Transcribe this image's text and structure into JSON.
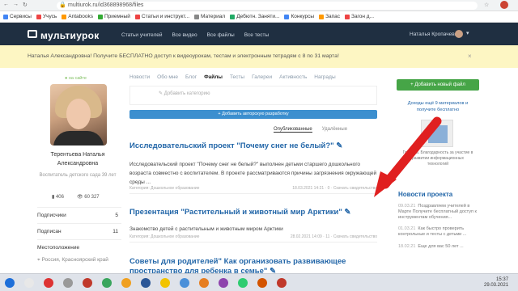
{
  "browser": {
    "url": "multiurok.ru/id368898968/files",
    "bookmarks": [
      "Сервисы",
      "Учусь",
      "Antabooks",
      "Приемный",
      "Статьи и инструкт...",
      "Материал",
      "Дебютн. Заняти...",
      "Конкурсы",
      "Запас",
      "Загон д..."
    ]
  },
  "header": {
    "logo": "мультиурок",
    "nav": [
      "Статьи учителей",
      "Все видео",
      "Все файлы",
      "Все тесты"
    ],
    "user": "Наталья Кропачева"
  },
  "banner": {
    "text": "Наталья Александровна! Получите БЕСПЛАТНО доступ к видеоурокам, тестам и электронным тетрадям с 8 по 31 марта!",
    "close": "×"
  },
  "profile": {
    "status": "на сайте",
    "name": "Терентьева Наталья Александровна",
    "role": "Воспитатель детского сада 39 лет",
    "stats": [
      "406",
      "60 327"
    ],
    "rows": [
      {
        "label": "Подписчики",
        "num": "5"
      },
      {
        "label": "Подписан",
        "num": "11"
      },
      {
        "label": "Местоположение",
        "num": ""
      },
      {
        "label": "Россия, Красноярский край",
        "num": ""
      }
    ]
  },
  "main": {
    "tabs": [
      "Новости",
      "Обо мне",
      "Блог",
      "Файлы",
      "Тесты",
      "Галереи",
      "Активность",
      "Награды"
    ],
    "category_hint": "Добавить категорию",
    "add_button": "Добавить авторскую разработку",
    "subtabs": [
      "Опубликованные",
      "Удалённые"
    ],
    "posts": [
      {
        "title": "Исследовательский проект \"Почему снег не белый?\"",
        "desc": "Исследовательский проект \"Почему снег не белый?\" выполнен детьми старшего дошкольного возраста совместно с воспитателем. В проекте рассматриваются причины загрязнения окружающей среды ...",
        "meta": "Категория: Дошкольное образование",
        "stats": "18.03.2021 14:21 · 0 · Скачать свидетельство"
      },
      {
        "title": "Презентация \"Растительный и животный мир Арктики\"",
        "desc": "Знакомство детей с растительным и животным миром Арктики",
        "meta": "Категория: Дошкольное образование",
        "stats": "28.02.2021 14:09 · 11 · Скачать свидетельство"
      },
      {
        "title": "Советы для родителей\" Как организовать развивающее пространство для ребенка в семье\"",
        "desc": "",
        "meta": "",
        "stats": ""
      }
    ]
  },
  "sidebar": {
    "add_file": "Добавить новый файл",
    "promo_title": "Доходы ещё 9 материалов и получите бесплатно",
    "promo_desc": "Грамота. Благодарность за участие в развитии информационных технологий",
    "news_heading": "Новости проекта",
    "news": [
      {
        "date": "09.03.21",
        "text": "Поздравляем учителей в Марте Получите бесплатный доступ к инструментам обучения..."
      },
      {
        "date": "01.03.21",
        "text": "Как быстро проверить контрольные и тесты с детьми ..."
      },
      {
        "date": "18.02.21",
        "text": "Еще для вас 50 лет ..."
      }
    ]
  },
  "taskbar": {
    "time": "15:37",
    "date": "29.03.2021"
  },
  "colors": {
    "header": "#1f2f41",
    "banner": "#fdf6c3",
    "link": "#2266a8",
    "accent_blue": "#3c8fcf",
    "green": "#46a547",
    "arrow": "#e02020"
  }
}
